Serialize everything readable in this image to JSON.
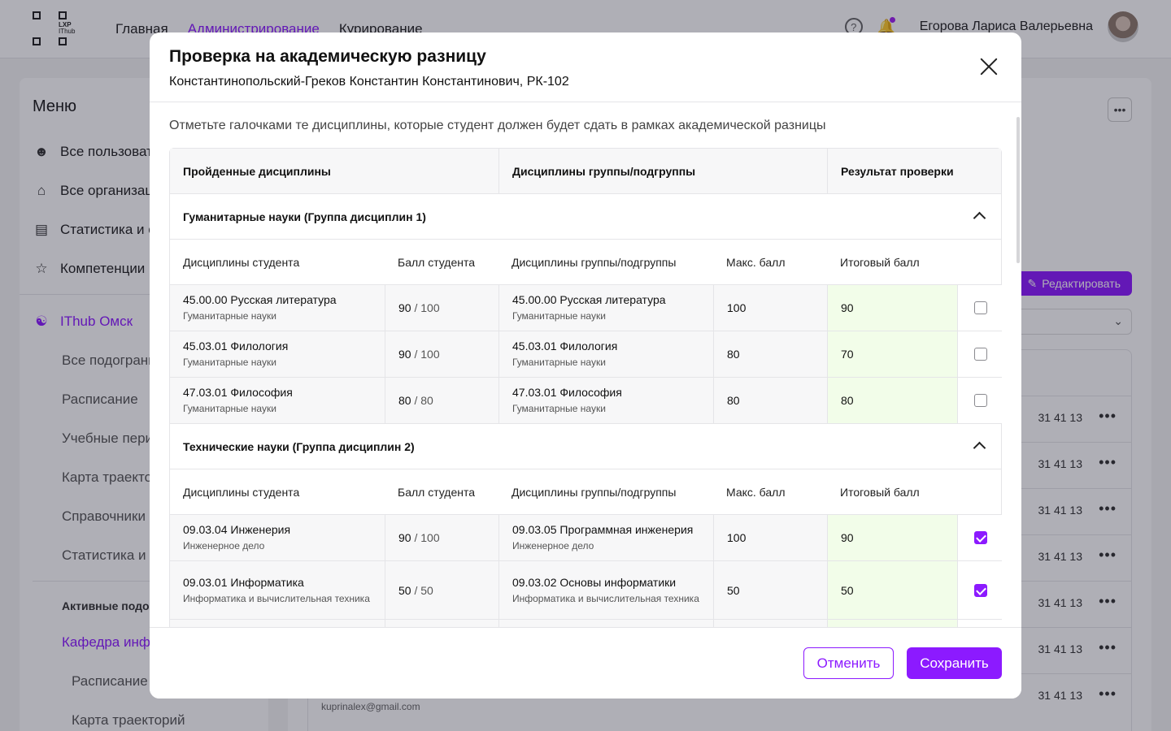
{
  "app": {
    "logo_text": [
      "LXP",
      "IThub"
    ],
    "nav": [
      {
        "label": "Главная"
      },
      {
        "label": "Администрирование"
      },
      {
        "label": "Курирование"
      }
    ],
    "help_icon": "question-circle-icon",
    "bell_icon": "bell-icon",
    "user_name": "Егорова Лариса Валерьевна"
  },
  "sidebar": {
    "title": "Меню",
    "items": [
      {
        "label": "Все пользователи",
        "icon": "user-icon"
      },
      {
        "label": "Все организации",
        "icon": "home-icon"
      },
      {
        "label": "Статистика и отчеты",
        "icon": "chart-icon"
      },
      {
        "label": "Компетенции",
        "icon": "star-icon"
      }
    ],
    "org": {
      "label": "IThub Омск",
      "icon": "org-tree-icon"
    },
    "sub_items": [
      {
        "label": "Все подогранизации"
      },
      {
        "label": "Расписание"
      },
      {
        "label": "Учебные периоды"
      },
      {
        "label": "Карта траекторий"
      },
      {
        "label": "Справочники"
      },
      {
        "label": "Статистика и отчеты"
      }
    ],
    "active_section": "Активные подорганизации",
    "department": "Кафедра информатики",
    "dept_items": [
      {
        "label": "Расписание"
      },
      {
        "label": "Карта траекторий"
      }
    ]
  },
  "background": {
    "edit_label": "Редактировать",
    "phones": [
      "31 41 13",
      "31 41 13",
      "31 41 13",
      "31 41 13",
      "31 41 13",
      "31 41 13",
      "31 41 13"
    ],
    "email": "kuprinalex@gmail.com"
  },
  "modal": {
    "title": "Проверка на академическую разницу",
    "subtitle": "Константинопольский-Греков Константин Константинович, РК-102",
    "hint": "Отметьте галочками те дисциплины, которые студент должен будет сдать в рамках академической разницы",
    "top_headers": [
      "Пройденные дисциплины",
      "Дисциплины группы/подгруппы",
      "Результат проверки"
    ],
    "sub_headers": [
      "Дисциплины студента",
      "Балл студента",
      "Дисциплины группы/подгруппы",
      "Макс. балл",
      "Итоговый балл"
    ],
    "groups": [
      {
        "title": "Гуманитарные науки (Группа дисциплин 1)",
        "rows": [
          {
            "student_disc": "45.00.00 Русская литература",
            "student_cat": "Гуманитарные науки",
            "score": "90",
            "score_max": "/ 100",
            "group_disc": "45.00.00 Русская литература",
            "group_cat": "Гуманитарные науки",
            "max": "100",
            "final": "90",
            "checked": false
          },
          {
            "student_disc": "45.03.01 Филология",
            "student_cat": "Гуманитарные науки",
            "score": "90",
            "score_max": "/ 100",
            "group_disc": "45.03.01 Филология",
            "group_cat": "Гуманитарные науки",
            "max": "80",
            "final": "70",
            "checked": false
          },
          {
            "student_disc": "47.03.01 Философия",
            "student_cat": "Гуманитарные науки",
            "score": "80",
            "score_max": "/ 80",
            "group_disc": "47.03.01 Философия",
            "group_cat": "Гуманитарные науки",
            "max": "80",
            "final": "80",
            "checked": false
          }
        ]
      },
      {
        "title": "Технические науки (Группа дисциплин 2)",
        "rows": [
          {
            "student_disc": "09.03.04 Инженерия",
            "student_cat": "Инженерное дело",
            "score": "90",
            "score_max": "/ 100",
            "group_disc": "09.03.05 Программная инженерия",
            "group_cat": "Инженерное дело",
            "max": "100",
            "final": "90",
            "checked": true
          },
          {
            "student_disc": "09.03.01 Информатика",
            "student_cat": "Информатика и вычислительная техника",
            "score": "50",
            "score_max": "/ 50",
            "group_disc": "09.03.02 Основы информатики",
            "group_cat": "Информатика и вычислительная техника",
            "max": "50",
            "final": "50",
            "checked": true
          }
        ]
      }
    ],
    "cancel_label": "Отменить",
    "save_label": "Сохранить"
  },
  "colors": {
    "accent": "#8c1aff",
    "result_bg": "#f2fde9"
  }
}
